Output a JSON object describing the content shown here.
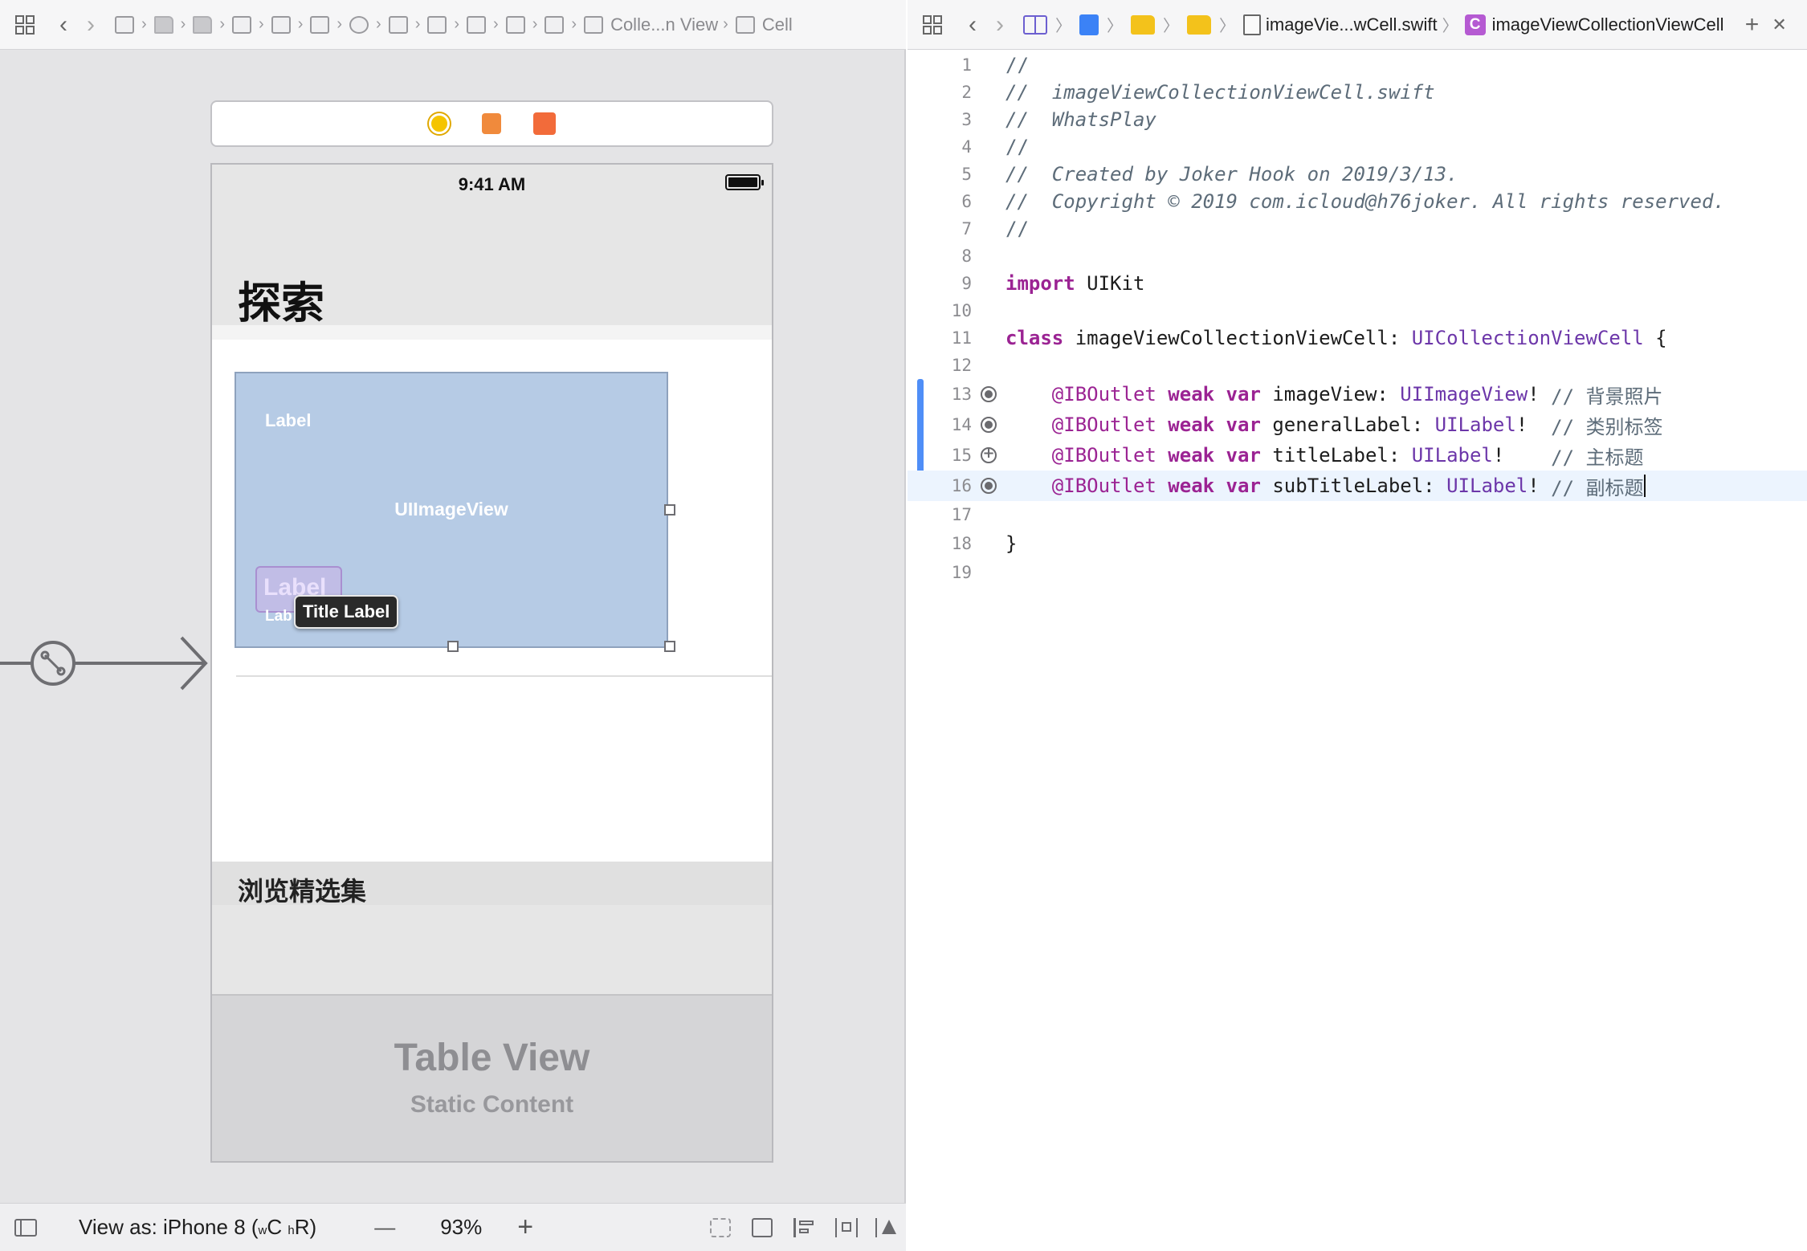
{
  "left_jumpbar": {
    "collection_view_crumb": "Colle...n View",
    "cell_crumb": "Cell"
  },
  "canvas": {
    "status_time": "9:41 AM",
    "large_title": "探索",
    "label_top": "Label",
    "image_view_label": "UIImageView",
    "label_selected": "Label",
    "label_under": "Lab",
    "tooltip": "Title Label",
    "section_title": "浏览精选集",
    "table_view_title": "Table View",
    "table_view_subtitle": "Static Content"
  },
  "bottom_bar": {
    "view_as_prefix": "View as: iPhone 8 (",
    "size_w": "w",
    "size_c": "C",
    "size_h": "h",
    "size_r": "R",
    "view_as_suffix": ")",
    "zoom_out": "—",
    "zoom": "93%",
    "zoom_in": "+"
  },
  "right_jumpbar": {
    "file_name": "imageVie...wCell.swift",
    "class_badge": "C",
    "class_name": "imageViewCollectionViewCell",
    "add": "+",
    "close": "✕"
  },
  "code": {
    "lines": [
      {
        "n": "1",
        "t": "//"
      },
      {
        "n": "2",
        "t": "//  imageViewCollectionViewCell.swift"
      },
      {
        "n": "3",
        "t": "//  WhatsPlay"
      },
      {
        "n": "4",
        "t": "//"
      },
      {
        "n": "5",
        "t": "//  Created by Joker Hook on 2019/3/13."
      },
      {
        "n": "6",
        "t": "//  Copyright © 2019 com.icloud@h76joker. All rights reserved."
      },
      {
        "n": "7",
        "t": "//"
      },
      {
        "n": "8",
        "t": ""
      },
      {
        "n": "10",
        "t": ""
      },
      {
        "n": "12",
        "t": ""
      },
      {
        "n": "17",
        "t": ""
      },
      {
        "n": "19",
        "t": ""
      }
    ],
    "line9": {
      "n": "9",
      "kw": "import",
      "rest": " UIKit"
    },
    "line11": {
      "n": "11",
      "kw": "class",
      "name": " imageViewCollectionViewCell: ",
      "type": "UICollectionViewCell",
      "rest": " {"
    },
    "outlets": [
      {
        "n": "13",
        "attr": "@IBOutlet",
        "kw": " weak var ",
        "name": "imageView: ",
        "type": "UIImageView",
        "bang": "! ",
        "comment": "// 背景照片"
      },
      {
        "n": "14",
        "attr": "@IBOutlet",
        "kw": " weak var ",
        "name": "generalLabel: ",
        "type": "UILabel",
        "bang": "!  ",
        "comment": "// 类别标签"
      },
      {
        "n": "15",
        "attr": "@IBOutlet",
        "kw": " weak var ",
        "name": "titleLabel: ",
        "type": "UILabel",
        "bang": "!    ",
        "comment": "// 主标题"
      },
      {
        "n": "16",
        "attr": "@IBOutlet",
        "kw": " weak var ",
        "name": "subTitleLabel: ",
        "type": "UILabel",
        "bang": "! ",
        "comment": "// 副标题"
      }
    ],
    "line18": {
      "n": "18",
      "t": "}"
    }
  },
  "colors": {
    "keyword": "#9b2393",
    "type": "#6c36a9",
    "comment": "#5d6c79",
    "image_view_bg": "#b6cbe5",
    "change_bar": "#4f8ef7",
    "current_line": "#ecf4fe"
  }
}
